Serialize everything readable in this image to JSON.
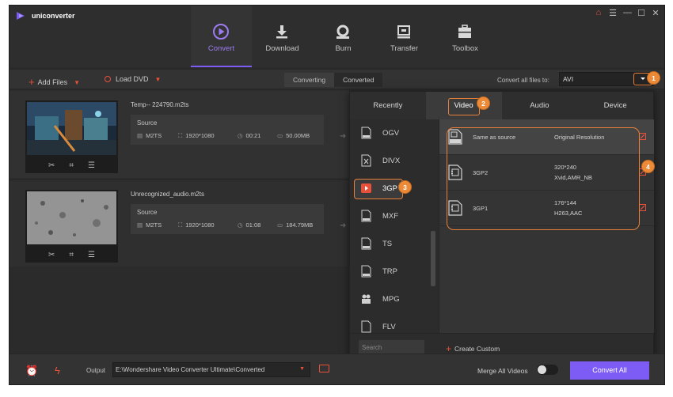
{
  "app": {
    "name": "uniconverter"
  },
  "nav": [
    {
      "label": "Convert",
      "icon": "convert-icon",
      "active": true
    },
    {
      "label": "Download",
      "icon": "download-icon"
    },
    {
      "label": "Burn",
      "icon": "burn-icon"
    },
    {
      "label": "Transfer",
      "icon": "transfer-icon"
    },
    {
      "label": "Toolbox",
      "icon": "toolbox-icon"
    }
  ],
  "toolbar": {
    "add_files": "Add Files",
    "load_dvd": "Load DVD",
    "tab_converting": "Converting",
    "tab_converted": "Converted",
    "convert_all_label": "Convert all files to:",
    "convert_all_value": "AVI"
  },
  "files": [
    {
      "name": "Temp-- 224790.m2ts",
      "source_label": "Source",
      "format": "M2TS",
      "resolution": "1920*1080",
      "duration": "00:21",
      "size": "50.00MB"
    },
    {
      "name": "Unrecognized_audio.m2ts",
      "source_label": "Source",
      "format": "M2TS",
      "resolution": "1920*1080",
      "duration": "01:08",
      "size": "184.79MB"
    }
  ],
  "panel": {
    "tabs": [
      "Recently",
      "Video",
      "Audio",
      "Device"
    ],
    "active_tab": "Video",
    "formats": [
      "OGV",
      "DIVX",
      "3GP",
      "MXF",
      "TS",
      "TRP",
      "MPG",
      "FLV"
    ],
    "active_format": "3GP",
    "options": [
      {
        "name": "Same as source",
        "detail1": "Original Resolution",
        "detail2": ""
      },
      {
        "name": "3GP2",
        "detail1": "320*240",
        "detail2": "Xvid,AMR_NB"
      },
      {
        "name": "3GP1",
        "detail1": "176*144",
        "detail2": "H263,AAC"
      }
    ],
    "search_placeholder": "Search",
    "create_custom": "Create Custom"
  },
  "callouts": [
    "1",
    "2",
    "3",
    "4"
  ],
  "footer": {
    "output_label": "Output",
    "output_path": "E:\\Wondershare Video Converter Ultimate\\Converted",
    "merge_label": "Merge All Videos",
    "merge_on": false,
    "convert_all": "Convert All"
  },
  "colors": {
    "accent": "#7c5cf4",
    "highlight": "#e8803a",
    "icon_red": "#e8503a",
    "background": "#2b2b2b"
  }
}
